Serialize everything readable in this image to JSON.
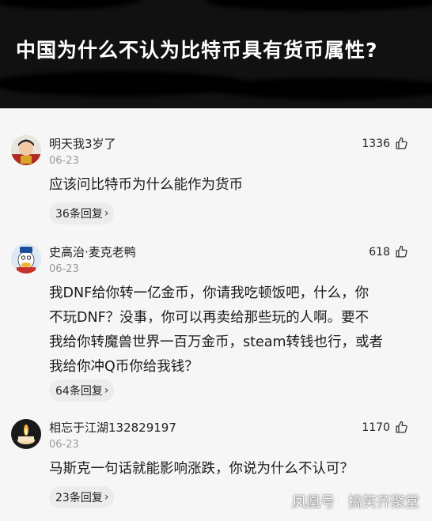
{
  "question": {
    "title": "中国为什么不认为比特币具有货币属性?"
  },
  "comments": [
    {
      "username": "明天我3岁了",
      "likes": "1336",
      "date": "06-23",
      "lines": [
        "应该问比特币为什么能作为货币"
      ],
      "replies": "36条回复"
    },
    {
      "username": "史高治·麦克老鸭",
      "likes": "618",
      "date": "06-23",
      "lines": [
        "我DNF给你转一亿金币，你请我吃顿饭吧，什么，你",
        "不玩DNF？没事，你可以再卖给那些玩的人啊。要不",
        "我给你转魔兽世界一百万金币，steam转钱也行，或者",
        "我给你冲Q币你给我钱？"
      ],
      "replies": "64条回复"
    },
    {
      "username": "相忘于江湖132829197",
      "likes": "1170",
      "date": "06-23",
      "lines": [
        "马斯克一句话就能影响涨跌，你说为什么不认可？"
      ],
      "replies": "23条回复"
    }
  ],
  "watermark": {
    "left": "凤凰号",
    "right": "搞笑齐聚堂"
  },
  "icons": {
    "like": "thumbs-up-icon",
    "chevron": "chevron-right-icon"
  }
}
